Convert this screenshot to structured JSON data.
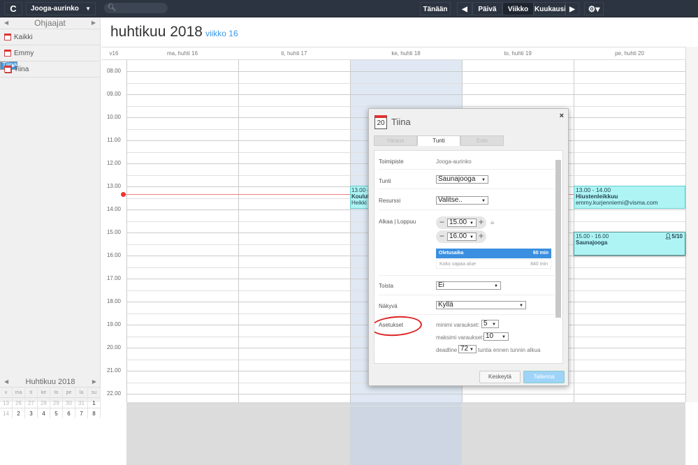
{
  "topbar": {
    "location": "Jooga-aurinko",
    "search_placeholder": "",
    "today": "Tänään",
    "day": "Päivä",
    "week": "Viikko",
    "month": "Kuukausi"
  },
  "sidebar": {
    "header": "Ohjaajat",
    "items": [
      {
        "label": "Kaikki"
      },
      {
        "label": "Emmy"
      },
      {
        "label": "Tiina",
        "selected": true
      },
      {
        "label": "Tiina"
      }
    ]
  },
  "mini_calendar": {
    "title": "Huhtikuu 2018",
    "weekdays": [
      "v",
      "ma",
      "ti",
      "ke",
      "to",
      "pe",
      "la",
      "su"
    ],
    "rows": [
      [
        "13",
        "26",
        "27",
        "28",
        "29",
        "30",
        "31",
        "1"
      ],
      [
        "14",
        "2",
        "3",
        "4",
        "5",
        "6",
        "7",
        "8"
      ]
    ]
  },
  "page": {
    "title": "huhtikuu 2018",
    "week": "viikko 16"
  },
  "calendar": {
    "week_label": "v16",
    "days": [
      "ma, huhti 16",
      "ti, huhti 17",
      "ke, huhti 18",
      "to, huhti 19",
      "pe, huhti 20"
    ],
    "hours": [
      "08.00",
      "09.00",
      "10.00",
      "11.00",
      "12.00",
      "13.00",
      "14.00",
      "15.00",
      "16.00",
      "17.00",
      "18.00",
      "19.00",
      "20.00",
      "21.00",
      "22.00"
    ],
    "events": [
      {
        "time": "13.00 - 14.00",
        "title": "Koulutus",
        "who": "Heikki"
      },
      {
        "time": "13.00 - 14.00",
        "title": "Hiustenleikkuu",
        "who": "emmy.kurjenniemi@visma.com"
      },
      {
        "time": "15.00 - 16.00",
        "title": "Saunajooga",
        "count": "5/10"
      }
    ]
  },
  "modal": {
    "day": "20",
    "title": "Tiina",
    "close": "×",
    "tabs": [
      "Varaus",
      "Tunti",
      "Esto"
    ],
    "toimipiste_label": "Toimipiste",
    "toimipiste": "Jooga-aurinko",
    "tunti_label": "Tunti",
    "tunti": "Saunajooga",
    "resurssi_label": "Resurssi",
    "resurssi": "Valitse..",
    "time_label": "Alkaa | Loppuu",
    "start": "15.00",
    "end": "16.00",
    "opt1": "Oletusaika",
    "opt1_len": "60 min",
    "opt2": "Koko vapaa alue",
    "opt2_len": "840 min",
    "toista_label": "Toista",
    "toista": "Ei",
    "nakyva_label": "Näkyvä",
    "nakyva": "Kyllä",
    "asetukset_label": "Asetukset",
    "min_label": "minimi varaukset:",
    "min": "5",
    "max_label": "maksimi varaukset:",
    "max": "10",
    "deadline_label": "deadline",
    "deadline": "72",
    "deadline_suffix": "tuntia ennen tunnin alkua",
    "cancel": "Keskeytä",
    "save": "Tallenna"
  },
  "colors": {
    "accent": "#3b97e3",
    "event": "#aef4f4",
    "topbar": "#2c3441"
  }
}
